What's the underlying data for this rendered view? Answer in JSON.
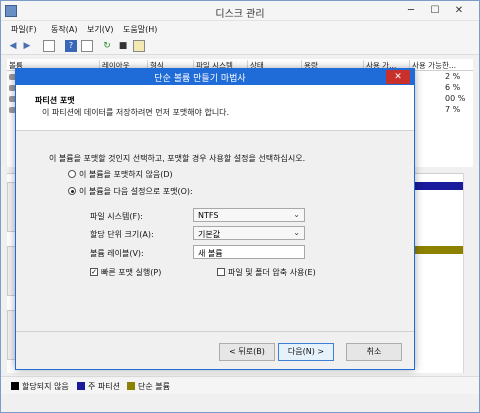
{
  "window": {
    "title": "디스크 관리",
    "controls": {
      "minimize": "─",
      "maximize": "☐",
      "close": "✕"
    }
  },
  "menu": [
    "파일(F)",
    "동작(A)",
    "보기(V)",
    "도움말(H)"
  ],
  "grid": {
    "columns": [
      "볼륨",
      "레이아웃",
      "형식",
      "파일 시스템",
      "상태",
      "용량",
      "사용 가...",
      "사용 가능한..."
    ],
    "percents": [
      "2 %",
      "6 %",
      "00 %",
      "7 %"
    ]
  },
  "legend": {
    "items": [
      {
        "label": "할당되지 않음",
        "color": "#000000"
      },
      {
        "label": "주 파티션",
        "color": "#1a1a9c"
      },
      {
        "label": "단순 볼륨",
        "color": "#8c8200"
      }
    ]
  },
  "dialog": {
    "title": "단순 볼륨 만들기 마법사",
    "close": "✕",
    "header_title": "파티션 포맷",
    "header_subtitle": "이 파티션에 데이터를 저장하려면 먼저 포맷해야 합니다.",
    "instruction": "이 볼륨을 포맷할 것인지 선택하고, 포맷할 경우 사용할 설정을 선택하십시오.",
    "option_no_format": "이 볼륨을 포맷하지 않음(D)",
    "option_format": "이 볼륨을 다음 설정으로 포맷(O):",
    "selected_option": "format",
    "fs_label": "파일 시스템(F):",
    "fs_value": "NTFS",
    "alloc_label": "할당 단위 크기(A):",
    "alloc_value": "기본값",
    "volume_label_label": "볼륨 레이블(V):",
    "volume_label_value": "새 볼륨",
    "quick_format_label": "빠른 포맷 실행(P)",
    "quick_format_checked": true,
    "compression_label": "파일 및 폴더 압축 사용(E)",
    "compression_checked": false,
    "back_button": "< 뒤로(B)",
    "next_button": "다음(N) >",
    "cancel_button": "취소"
  }
}
